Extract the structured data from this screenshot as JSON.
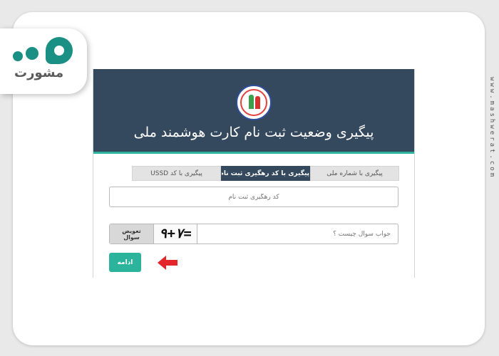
{
  "brand": {
    "logo_text": "مشورت",
    "side_url": "www.mashwerat.com",
    "accent": "#1a8f83"
  },
  "page": {
    "header_title": "پیگیری وضعیت ثبت نام کارت هوشمند ملی",
    "header_color": "#35495e",
    "accent_color": "#2bb39b"
  },
  "tabs": [
    {
      "label": "پیگیری با شماره ملی",
      "active": false
    },
    {
      "label": "پیگیری با کد رهگیری ثبت نام",
      "active": true
    },
    {
      "label": "پیگیری با کد USSD",
      "active": false
    }
  ],
  "form": {
    "tracking_placeholder": "کد رهگیری ثبت نام",
    "captcha_placeholder": "جواب سوال چیست ؟",
    "captcha_text": "۹+۷=",
    "refresh_label": "تعویض سوال",
    "continue_label": "ادامه"
  },
  "icons": {
    "emblem": "national-registry-emblem-icon",
    "arrow": "red-arrow-left-icon"
  }
}
